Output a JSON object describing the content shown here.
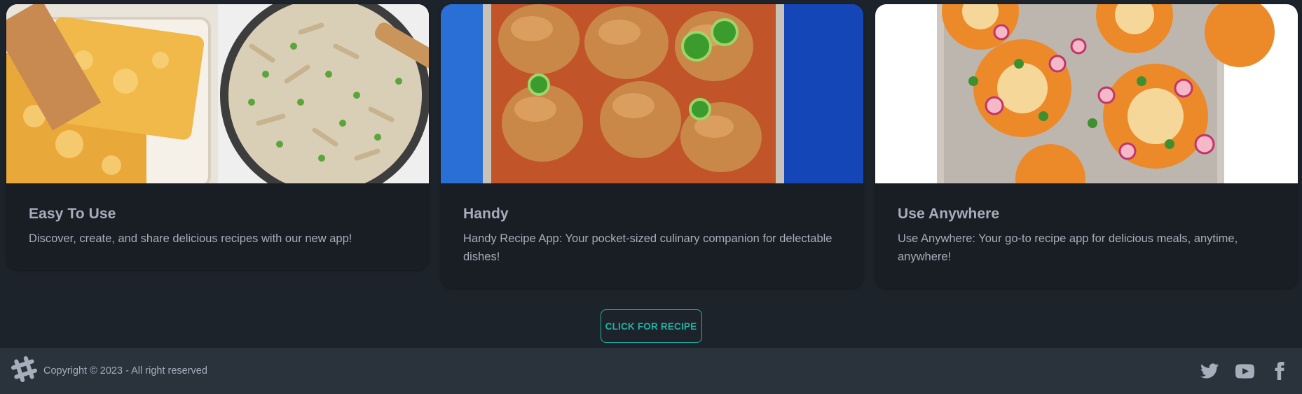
{
  "cards": [
    {
      "title": "Easy To Use",
      "text": "Discover, create, and share delicious recipes with our new app!",
      "image": "casserole-and-pasta-photo"
    },
    {
      "title": "Handy",
      "text": "Handy Recipe App: Your pocket-sized culinary companion for delectable dishes!",
      "image": "sliders-with-jalapenos-photo"
    },
    {
      "title": "Use Anywhere",
      "text": "Use Anywhere: Your go-to recipe app for delicious meals, anytime, anywhere!",
      "image": "tostadas-on-sheet-pan-photo"
    }
  ],
  "cta": {
    "label": "CLICK FOR RECIPE"
  },
  "footer": {
    "copyright": "Copyright © 2023 - All right reserved",
    "logo_icon": "hashtag-logo-icon",
    "social": [
      "twitter-icon",
      "youtube-icon",
      "facebook-icon"
    ]
  },
  "colors": {
    "page_bg": "#1d232a",
    "card_bg": "#191e24",
    "footer_bg": "#2a323c",
    "accent": "#1fb2a6",
    "text": "#a6adbb"
  }
}
